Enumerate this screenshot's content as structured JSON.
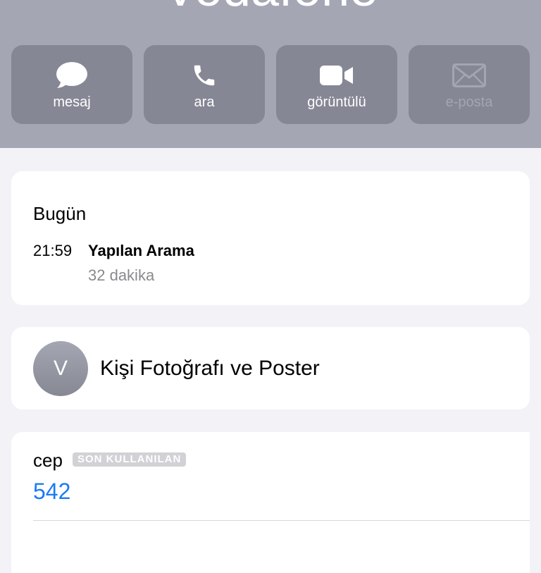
{
  "contact": {
    "name": "Vodafone"
  },
  "actions": [
    {
      "label": "mesaj",
      "icon": "message-bubble-icon",
      "enabled": true
    },
    {
      "label": "ara",
      "icon": "phone-icon",
      "enabled": true
    },
    {
      "label": "görüntülü",
      "icon": "video-camera-icon",
      "enabled": true
    },
    {
      "label": "e-posta",
      "icon": "envelope-icon",
      "enabled": false
    }
  ],
  "recents": {
    "day": "Bugün",
    "calls": [
      {
        "time": "21:59",
        "type": "Yapılan Arama",
        "duration": "32 dakika"
      }
    ]
  },
  "poster": {
    "initial": "V",
    "label": "Kişi Fotoğrafı ve Poster"
  },
  "phone": {
    "label": "cep",
    "badge": "SON KULLANILAN",
    "number": "542"
  },
  "colors": {
    "header": "#a5a6b4",
    "button": "#858795",
    "link": "#1a7cf5",
    "background": "#f2f2f7"
  }
}
